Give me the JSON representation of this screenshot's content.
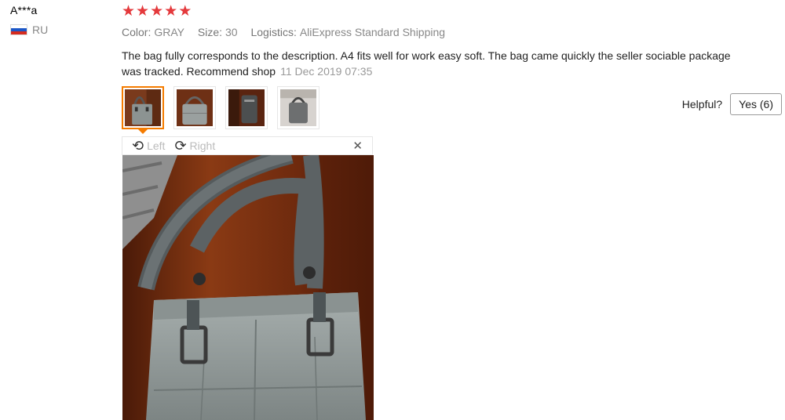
{
  "reviewer": {
    "name": "A***a",
    "country": "RU"
  },
  "rating": {
    "stars": 5,
    "max": 5
  },
  "meta": {
    "color_label": "Color:",
    "color_value": "GRAY",
    "size_label": "Size:",
    "size_value": "30",
    "logistics_label": "Logistics:",
    "logistics_value": "AliExpress Standard Shipping"
  },
  "review": {
    "text": "The bag fully corresponds to the description. A4 fits well for work easy soft. The bag came quickly the seller sociable package was tracked. Recommend shop",
    "date": "11 Dec 2019 07:35"
  },
  "thumbnails": [
    "photo-1",
    "photo-2",
    "photo-3",
    "photo-4"
  ],
  "helpful": {
    "label": "Helpful?",
    "yes_button": "Yes (6)"
  },
  "viewer": {
    "rotate_left_label": "Left",
    "rotate_right_label": "Right",
    "rotate_left_icon": "rotate-left-icon",
    "rotate_right_icon": "rotate-right-icon",
    "close_icon": "close-icon"
  },
  "colors": {
    "star": "#e4393c",
    "active_border": "#f57c00"
  }
}
